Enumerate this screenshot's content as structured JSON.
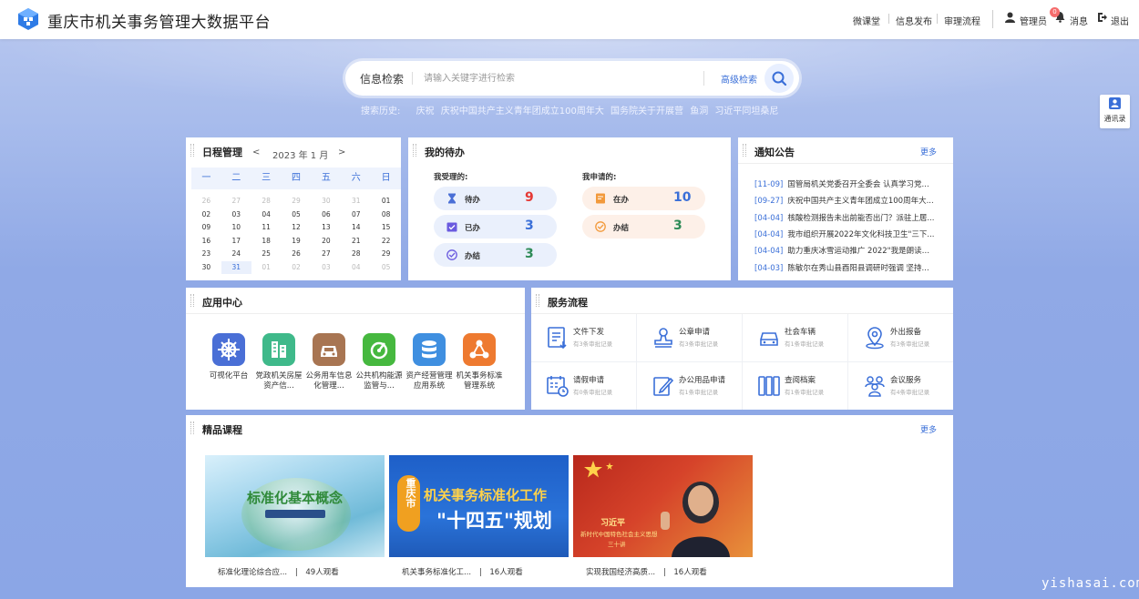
{
  "header": {
    "title": "重庆市机关事务管理大数据平台",
    "nav": [
      "微课堂",
      "信息发布",
      "审理流程"
    ],
    "user": "管理员",
    "message_label": "消息",
    "message_count": "0",
    "logout": "退出"
  },
  "search": {
    "label": "信息检索",
    "placeholder": "请输入关键字进行检索",
    "advanced": "高级检索",
    "history_label": "搜索历史:",
    "history": [
      "庆祝",
      "庆祝中国共产主义青年团成立100周年大",
      "国务院关于开展营",
      "鱼洞",
      "习近平同坦桑尼"
    ]
  },
  "contact": {
    "label": "通讯录"
  },
  "calendar": {
    "title": "日程管理",
    "month": "2023 年 1 月",
    "prev": "<",
    "next": ">",
    "weekdays": [
      "一",
      "二",
      "三",
      "四",
      "五",
      "六",
      "日"
    ],
    "rows": [
      [
        "26",
        "27",
        "28",
        "29",
        "30",
        "31",
        "01"
      ],
      [
        "02",
        "03",
        "04",
        "05",
        "06",
        "07",
        "08"
      ],
      [
        "09",
        "10",
        "11",
        "12",
        "13",
        "14",
        "15"
      ],
      [
        "16",
        "17",
        "18",
        "19",
        "20",
        "21",
        "22"
      ],
      [
        "23",
        "24",
        "25",
        "26",
        "27",
        "28",
        "29"
      ],
      [
        "30",
        "31",
        "01",
        "02",
        "03",
        "04",
        "05"
      ]
    ]
  },
  "todo": {
    "title": "我的待办",
    "received_title": "我受理的:",
    "applied_title": "我申请的:",
    "received": [
      {
        "label": "待办",
        "value": "9",
        "color": "#e53935"
      },
      {
        "label": "已办",
        "value": "3",
        "color": "#3a6fd8"
      },
      {
        "label": "办结",
        "value": "3",
        "color": "#2e8b57"
      }
    ],
    "applied": [
      {
        "label": "在办",
        "value": "10",
        "color": "#3a6fd8"
      },
      {
        "label": "办结",
        "value": "3",
        "color": "#2e8b57"
      }
    ]
  },
  "notices": {
    "title": "通知公告",
    "more": "更多",
    "items": [
      {
        "date": "[11-09]",
        "text": "国管局机关党委召开全委会 认真学习党..."
      },
      {
        "date": "[09-27]",
        "text": "庆祝中国共产主义青年团成立100周年大..."
      },
      {
        "date": "[04-04]",
        "text": "核酸检测报告未出前能否出门？派驻上居..."
      },
      {
        "date": "[04-04]",
        "text": "我市组织开展2022年文化科技卫生\"三下..."
      },
      {
        "date": "[04-04]",
        "text": "助力重庆冰雪运动推广 2022\"我是朗读者\"..."
      },
      {
        "date": "[04-03]",
        "text": "陈敏尔在秀山县酉阳县调研时强调 坚持..."
      }
    ]
  },
  "apps": {
    "title": "应用中心",
    "items": [
      {
        "name": "可视化平台",
        "color": "#4a6fd6",
        "icon": "helm-icon"
      },
      {
        "name": "党政机关房屋资产信...",
        "color": "#3fb98a",
        "icon": "building-icon"
      },
      {
        "name": "公务用车信息化管理...",
        "color": "#a87552",
        "icon": "car-icon"
      },
      {
        "name": "公共机构能源监管与...",
        "color": "#46b83f",
        "icon": "energy-icon"
      },
      {
        "name": "资产经营管理应用系统",
        "color": "#3f8fe0",
        "icon": "database-icon"
      },
      {
        "name": "机关事务标准管理系统",
        "color": "#ee7a30",
        "icon": "network-icon"
      }
    ]
  },
  "services": {
    "title": "服务流程",
    "items": [
      {
        "name": "文件下发",
        "sub": "有3条审批记录",
        "icon": "document-icon"
      },
      {
        "name": "公章申请",
        "sub": "有3条审批记录",
        "icon": "stamp-icon"
      },
      {
        "name": "社会车辆",
        "sub": "有1条审批记录",
        "icon": "car-icon"
      },
      {
        "name": "外出报备",
        "sub": "有3条审批记录",
        "icon": "location-icon"
      },
      {
        "name": "请假申请",
        "sub": "有0条审批记录",
        "icon": "calendar-icon"
      },
      {
        "name": "办公用品申请",
        "sub": "有1条审批记录",
        "icon": "edit-icon"
      },
      {
        "name": "查阅档案",
        "sub": "有1条审批记录",
        "icon": "archive-icon"
      },
      {
        "name": "会议服务",
        "sub": "有4条审批记录",
        "icon": "people-icon"
      }
    ]
  },
  "courses": {
    "title": "精品课程",
    "more": "更多",
    "items": [
      {
        "title": "标准化理论综合应...",
        "sep": "|",
        "views": "49人观看",
        "img_text": "标准化基本概念"
      },
      {
        "title": "机关事务标准化工...",
        "sep": "|",
        "views": "16人观看",
        "img_text": "机关事务标准化工作",
        "img_text2": "\"十四五\"规划",
        "img_side": "重庆市"
      },
      {
        "title": "实现我国经济高质...",
        "sep": "|",
        "views": "16人观看",
        "img_text": "习近平",
        "img_text2": "新时代中国特色社会主义思想",
        "img_text3": "三十讲"
      }
    ]
  },
  "watermark": "yishasai.com"
}
